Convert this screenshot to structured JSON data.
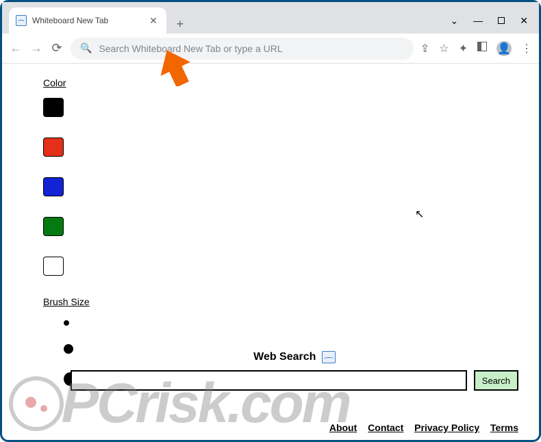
{
  "browser": {
    "tab_title": "Whiteboard New Tab",
    "omnibox_placeholder": "Search Whiteboard New Tab or type a URL"
  },
  "sidebar": {
    "color_heading": "Color",
    "brush_heading": "Brush Size",
    "colors": [
      "black",
      "red",
      "blue",
      "green",
      "white"
    ]
  },
  "search": {
    "title": "Web Search",
    "button": "Search"
  },
  "footer": {
    "links": [
      "About",
      "Contact",
      "Privacy Policy",
      "Terms"
    ]
  },
  "watermark": {
    "text": "PCrisk.com"
  }
}
